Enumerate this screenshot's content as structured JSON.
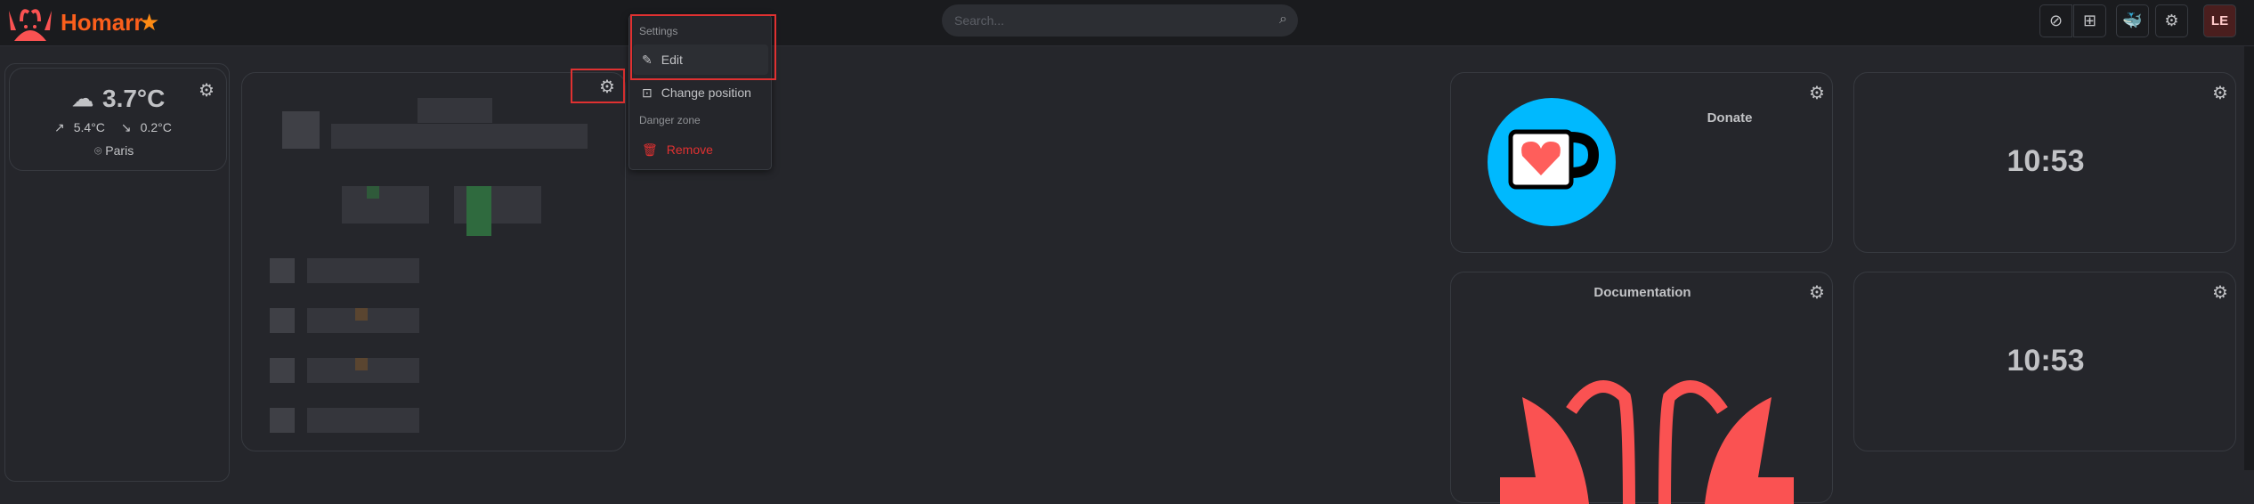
{
  "header": {
    "app_name": "Homarr",
    "search_placeholder": "Search...",
    "avatar_initials": "LE",
    "buttons": [
      "toggle-edit-mode",
      "add-tile",
      "docker",
      "settings"
    ]
  },
  "weather": {
    "temperature": "3.7°C",
    "max": "5.4°C",
    "min": "0.2°C",
    "location": "Paris"
  },
  "menu": {
    "section_settings": "Settings",
    "edit": "Edit",
    "change_position": "Change position",
    "section_danger": "Danger zone",
    "remove": "Remove"
  },
  "tiles": {
    "donate_label": "Donate",
    "documentation_label": "Documentation",
    "clock1": "10:53",
    "clock2": "10:53"
  },
  "colors": {
    "brand": "#fa5f1c",
    "danger": "#e03131",
    "kofi_blue": "#00b9fe",
    "logo_red": "#fa5252"
  }
}
